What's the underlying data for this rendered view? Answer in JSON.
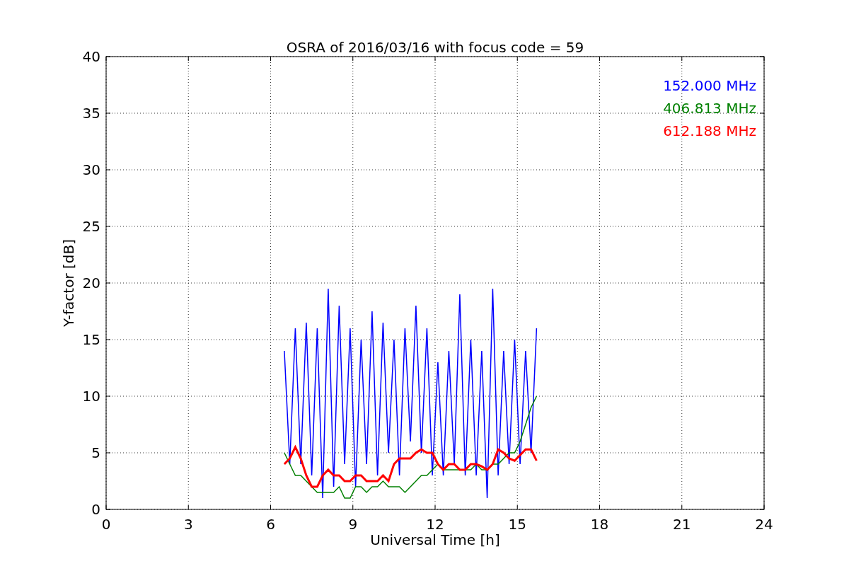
{
  "chart_data": {
    "type": "line",
    "title": "OSRA of 2016/03/16 with focus code = 59",
    "xlabel": "Universal Time [h]",
    "ylabel": "Y-factor [dB]",
    "x": [
      6.5,
      6.7,
      6.9,
      7.1,
      7.3,
      7.5,
      7.7,
      7.9,
      8.1,
      8.3,
      8.5,
      8.7,
      8.9,
      9.1,
      9.3,
      9.5,
      9.7,
      9.9,
      10.1,
      10.3,
      10.5,
      10.7,
      10.9,
      11.1,
      11.3,
      11.5,
      11.7,
      11.9,
      12.1,
      12.3,
      12.5,
      12.7,
      12.9,
      13.1,
      13.3,
      13.5,
      13.7,
      13.9,
      14.1,
      14.3,
      14.5,
      14.7,
      14.9,
      15.1,
      15.3,
      15.5,
      15.7
    ],
    "series": [
      {
        "name": "152.000 MHz",
        "color": "#0000ff",
        "values": [
          14,
          4,
          16,
          4,
          16.5,
          3,
          16,
          1,
          19.5,
          2,
          18,
          4,
          16,
          2,
          15,
          4,
          17.5,
          3,
          16.5,
          5,
          15,
          3,
          16,
          6,
          18,
          5,
          16,
          3,
          13,
          3,
          14,
          4,
          19,
          3,
          15,
          3,
          14,
          1,
          19.5,
          3,
          14,
          4,
          15,
          4,
          14,
          5,
          16
        ]
      },
      {
        "name": "406.813 MHz",
        "color": "#008000",
        "values": [
          5,
          4,
          3,
          3,
          2.5,
          2,
          1.5,
          1.5,
          1.5,
          1.5,
          2,
          1,
          1,
          2,
          2,
          1.5,
          2,
          2,
          2.5,
          2,
          2,
          2,
          1.5,
          2,
          2.5,
          3,
          3,
          3.5,
          4,
          3.5,
          3.5,
          3.5,
          3.5,
          3.5,
          3.5,
          4,
          3.5,
          3.5,
          4,
          4,
          4.5,
          5,
          5,
          6,
          7.5,
          9,
          10
        ]
      },
      {
        "name": "612.188 MHz",
        "color": "#ff0000",
        "values": [
          4,
          4.5,
          5.5,
          4.5,
          3,
          2,
          2,
          3,
          3.5,
          3,
          3,
          2.5,
          2.5,
          3,
          3,
          2.5,
          2.5,
          2.5,
          3,
          2.5,
          4,
          4.5,
          4.5,
          4.5,
          5,
          5.3,
          5,
          5,
          4,
          3.5,
          4,
          4,
          3.5,
          3.5,
          4,
          4,
          3.8,
          3.5,
          4,
          5.3,
          5,
          4.5,
          4.3,
          4.8,
          5.3,
          5.3,
          4.3
        ]
      }
    ],
    "grid": true,
    "xlim": [
      0,
      24
    ],
    "ylim": [
      0,
      40
    ],
    "xticks": [
      0,
      3,
      6,
      9,
      12,
      15,
      18,
      21,
      24
    ],
    "yticks": [
      0,
      5,
      10,
      15,
      20,
      25,
      30,
      35,
      40
    ]
  }
}
